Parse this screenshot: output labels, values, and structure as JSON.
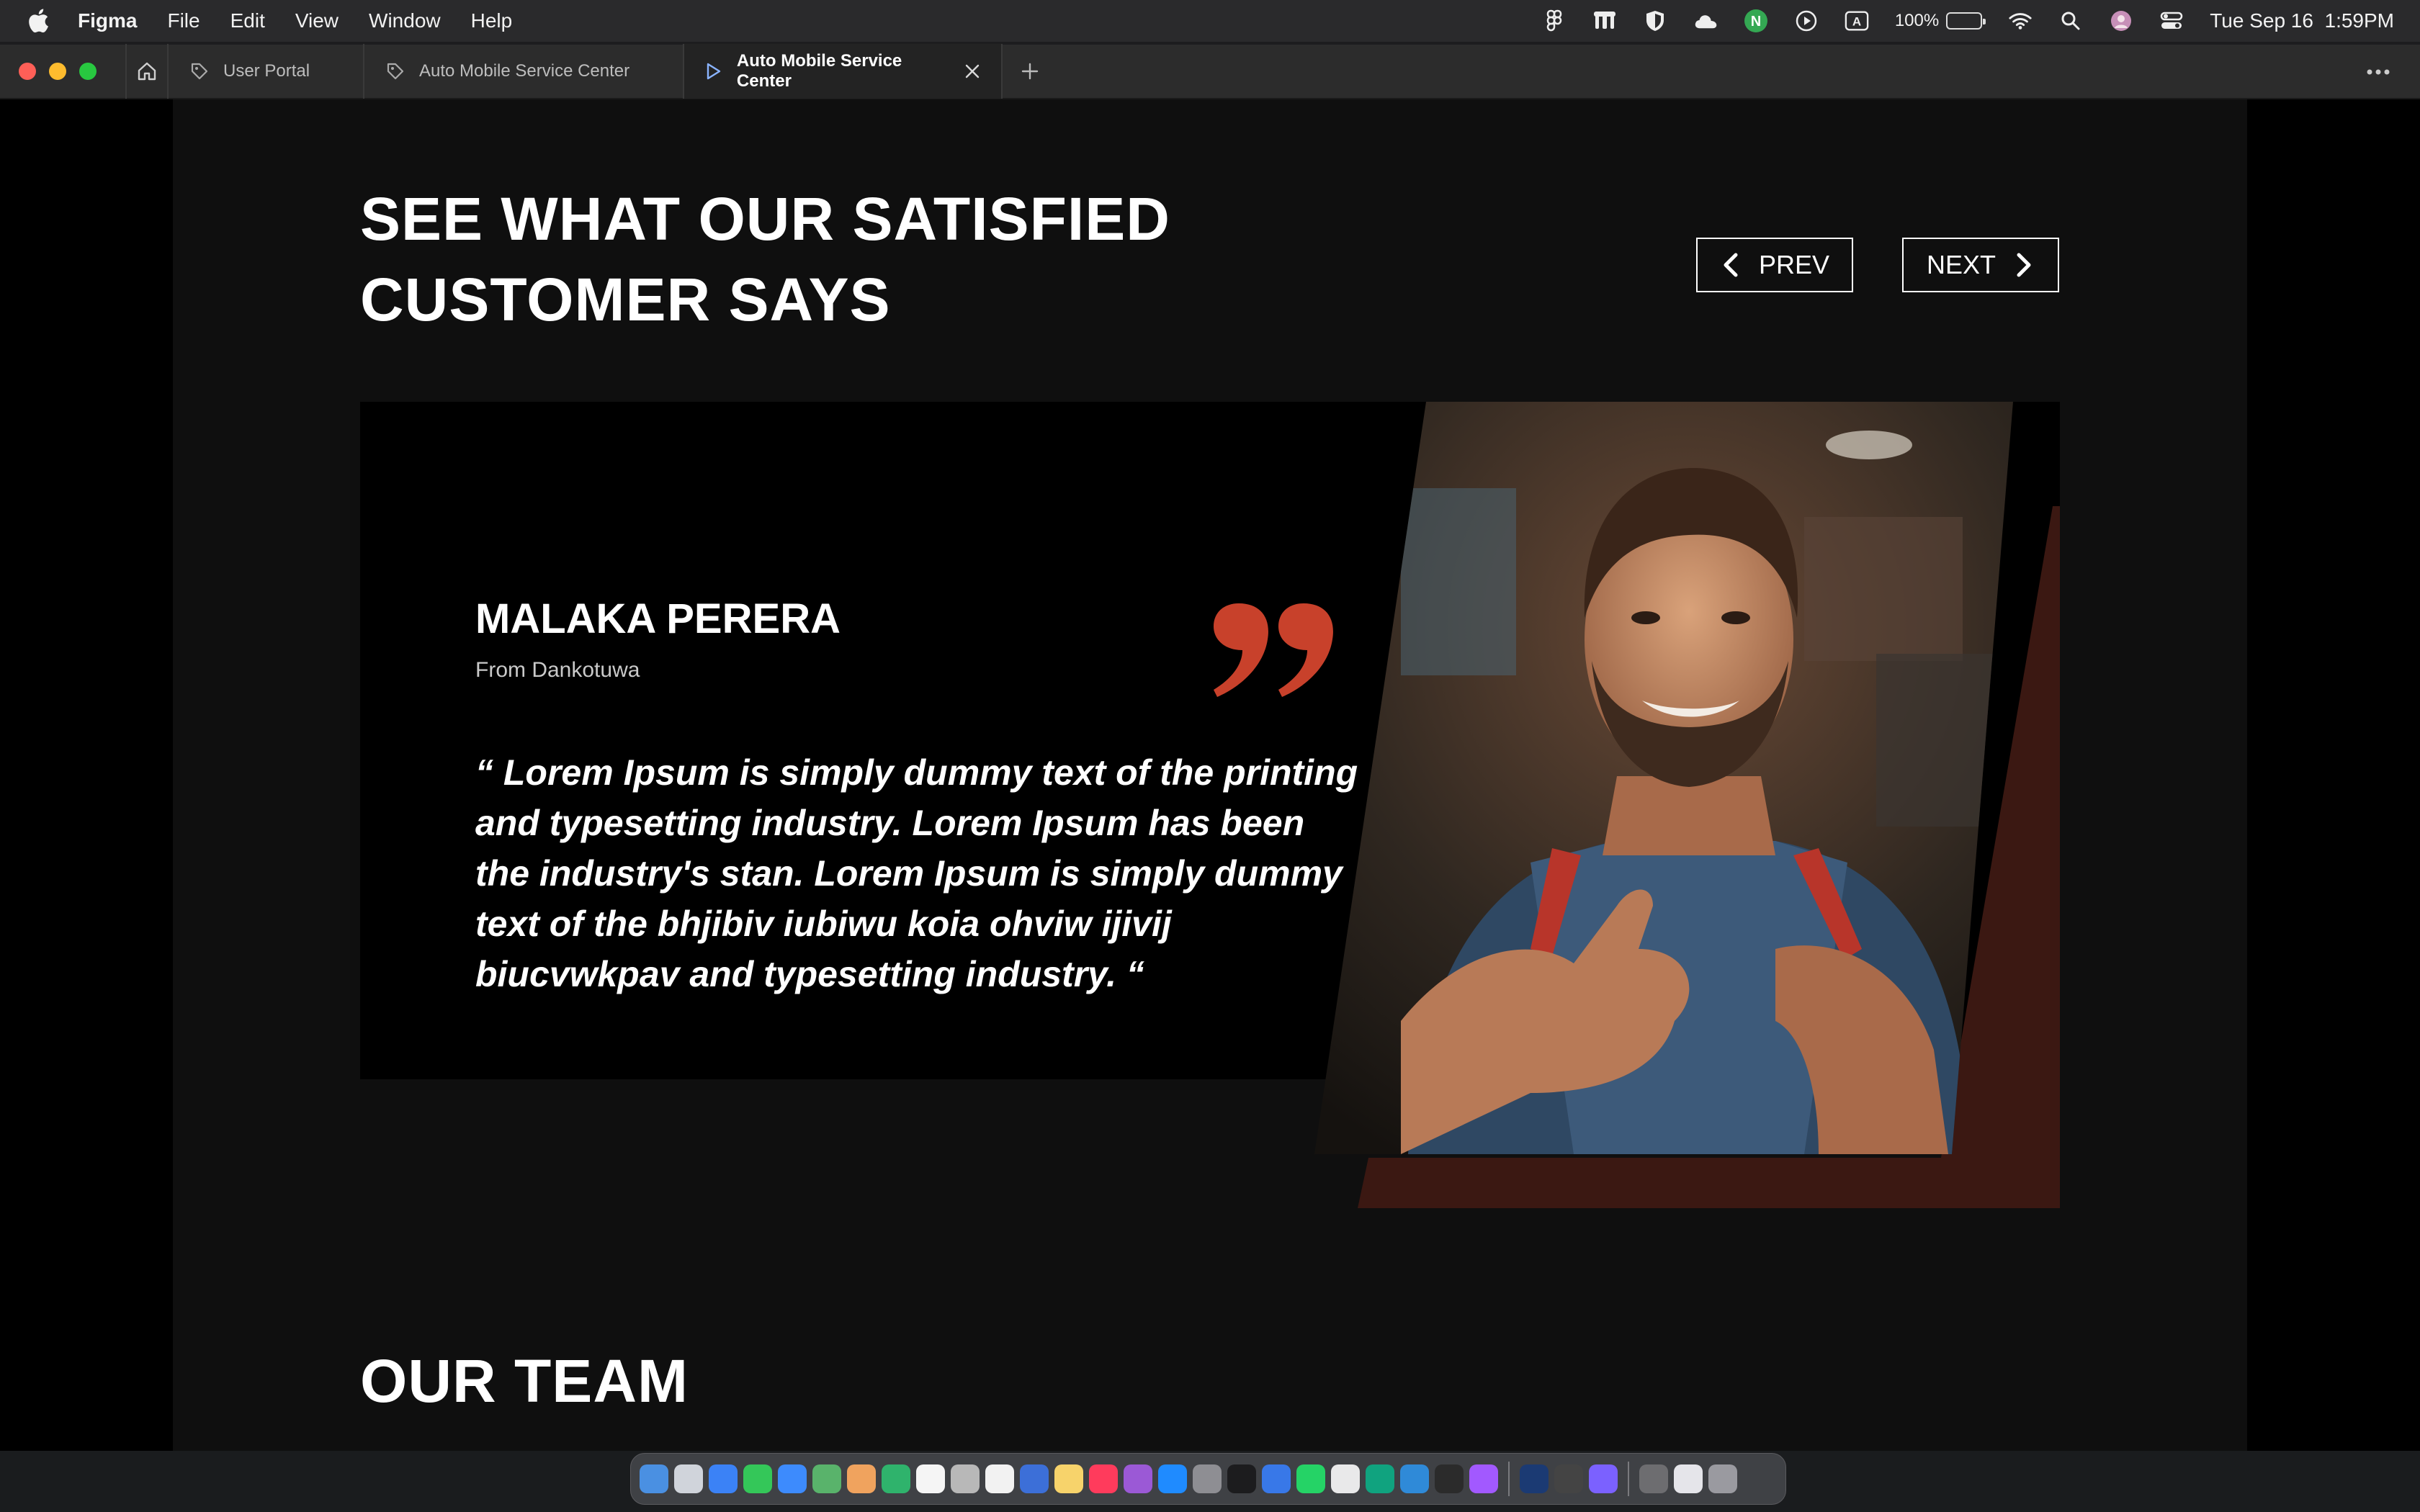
{
  "menubar": {
    "app_name": "Figma",
    "menus": [
      "File",
      "Edit",
      "View",
      "Window",
      "Help"
    ],
    "battery_percent": "100%",
    "battery_level": 1.0,
    "datetime": "Tue Sep 16  1:59PM"
  },
  "tabs": [
    {
      "label": "User Portal",
      "icon": "figma-file-icon",
      "active": false
    },
    {
      "label": "Auto Mobile Service Center",
      "icon": "figma-file-icon",
      "active": false
    },
    {
      "label": "Auto Mobile Service Center",
      "icon": "play-prototype-icon",
      "active": true
    }
  ],
  "page": {
    "heading_line1": "SEE WHAT OUR SATISFIED",
    "heading_line2": "CUSTOMER SAYS",
    "prev_label": "PREV",
    "next_label": "NEXT",
    "customer_name": "MALAKA PERERA",
    "customer_from": "From Dankotuwa",
    "quote": "“ Lorem Ipsum is simply dummy text of the printing and typesetting industry. Lorem Ipsum has been the industry's stan. Lorem Ipsum is simply dummy text of the bhjibiv iubiwu koia ohviw ijivij biucvwkpav and typesetting industry. “",
    "team_heading": "OUR TEAM",
    "accent_color": "#c8412b",
    "accent_dark": "#3d1a14"
  },
  "dock": {
    "icons": [
      "finder-icon",
      "launchpad-icon",
      "safari-icon",
      "messages-icon",
      "mail-icon",
      "maps-icon",
      "photos-icon",
      "facetime-icon",
      "calendar-icon",
      "contacts-icon",
      "reminders-icon",
      "freeform-icon",
      "notes-icon",
      "music-icon",
      "podcasts-icon",
      "app-store-icon",
      "settings-icon",
      "tv-icon",
      "files-icon",
      "whatsapp-icon",
      "textedit-icon",
      "chatgpt-icon",
      "vscode-icon",
      "terminal-icon",
      "figma-icon",
      "photoshop-icon",
      "console-icon",
      "arc-icon",
      "downloads-icon",
      "document-icon",
      "trash-icon"
    ]
  }
}
